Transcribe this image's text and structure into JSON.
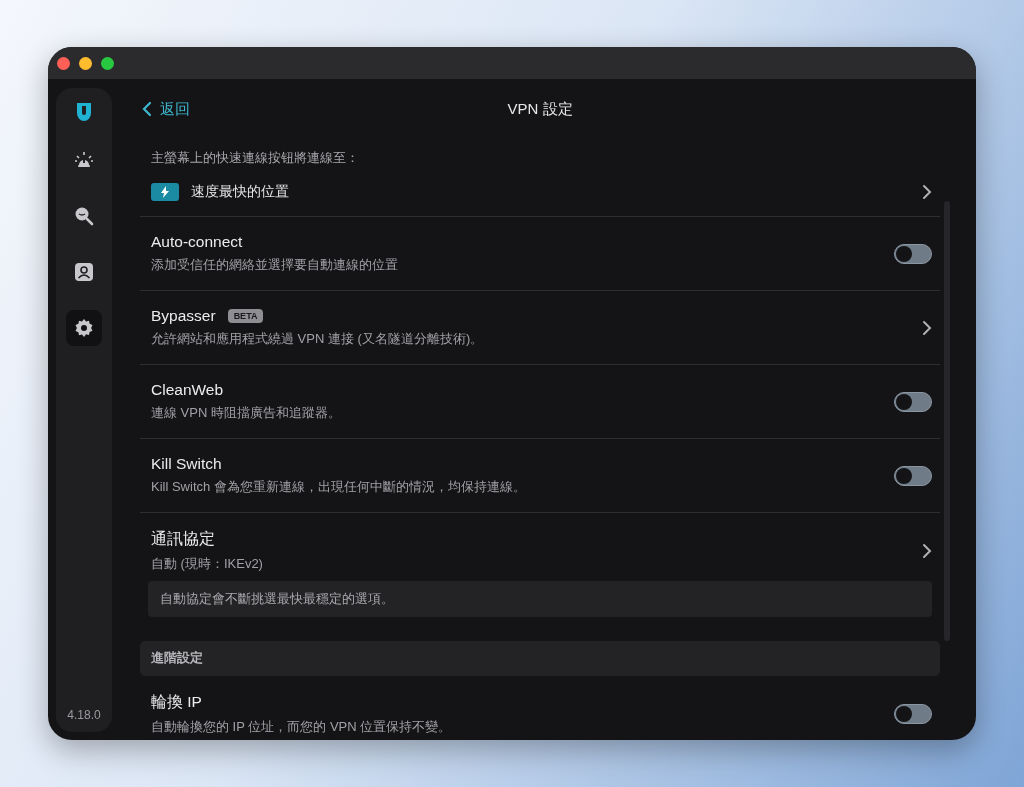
{
  "sidebar": {
    "items": [
      {
        "kind": "alert",
        "selected": false
      },
      {
        "kind": "search",
        "selected": false
      },
      {
        "kind": "account",
        "selected": false
      },
      {
        "kind": "settings",
        "selected": true
      }
    ],
    "version": "4.18.0"
  },
  "header": {
    "back": "返回",
    "title": "VPN 設定"
  },
  "quick_connect": {
    "caption": "主螢幕上的快速連線按钮將連線至：",
    "target": "速度最快的位置"
  },
  "rows": [
    {
      "kind": "toggle",
      "title": "Auto-connect",
      "description": "添加受信任的網絡並選擇要自動連線的位置",
      "on": false
    },
    {
      "kind": "link",
      "title": "Bypasser",
      "badge": "BETA",
      "description": "允許網站和應用程式繞過 VPN 連接 (又名隧道分離技術)。"
    },
    {
      "kind": "toggle",
      "title": "CleanWeb",
      "description": "連線 VPN 時阻擋廣告和追蹤器。",
      "on": false
    },
    {
      "kind": "toggle",
      "title": "Kill Switch",
      "description": "Kill Switch 會為您重新連線，出現任何中斷的情況，均保持連線。",
      "on": false
    },
    {
      "kind": "link",
      "title": "通訊協定",
      "description": "自動 (現時：IKEv2)",
      "note": "自動協定會不斷挑選最快最穩定的選項。"
    }
  ],
  "advanced": {
    "heading": "進階設定",
    "rows": [
      {
        "kind": "toggle",
        "title": "輪換 IP",
        "description": "自動輪換您的 IP 位址，而您的 VPN 位置保持不變。",
        "on": false
      }
    ]
  }
}
